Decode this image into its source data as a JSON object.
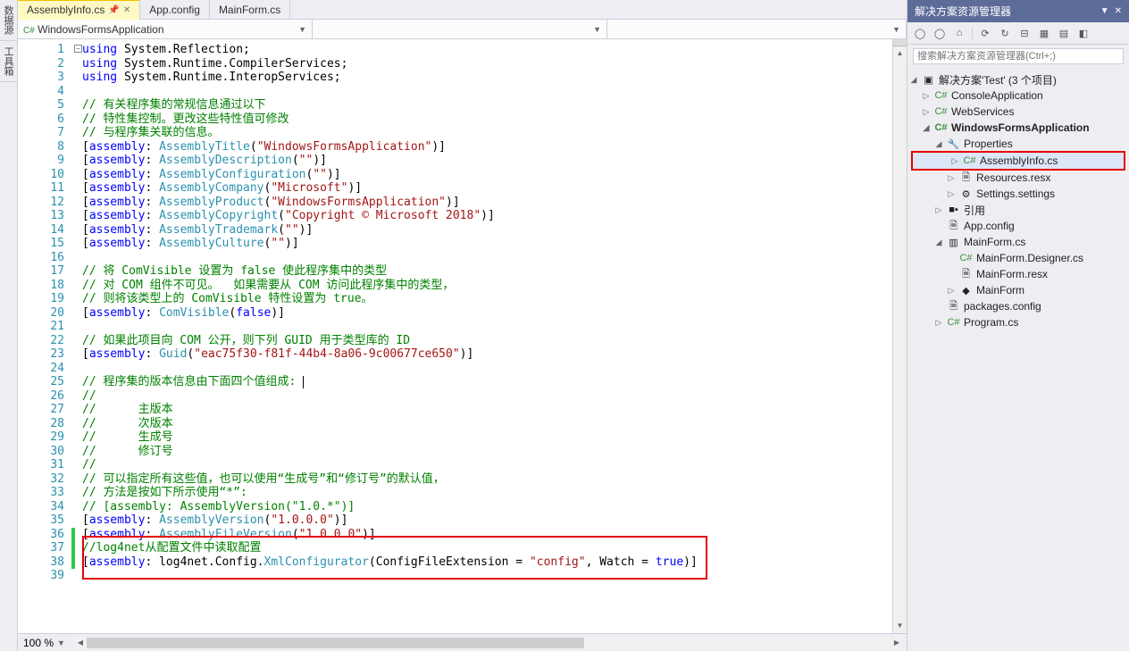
{
  "side_tabs": [
    "数据源",
    "工具箱"
  ],
  "tabs": [
    {
      "label": "AssemblyInfo.cs",
      "active": true
    },
    {
      "label": "App.config",
      "active": false
    },
    {
      "label": "MainForm.cs",
      "active": false
    }
  ],
  "dropdowns": {
    "namespace": "WindowsFormsApplication",
    "class": "",
    "member": ""
  },
  "code_lines": [
    {
      "n": 1,
      "seg": [
        [
          "kw",
          "using"
        ],
        [
          "",
          " System.Reflection;"
        ]
      ]
    },
    {
      "n": 2,
      "seg": [
        [
          "kw",
          "using"
        ],
        [
          "",
          " System.Runtime.CompilerServices;"
        ]
      ]
    },
    {
      "n": 3,
      "seg": [
        [
          "kw",
          "using"
        ],
        [
          "",
          " System.Runtime.InteropServices;"
        ]
      ]
    },
    {
      "n": 4,
      "seg": []
    },
    {
      "n": 5,
      "seg": [
        [
          "cm",
          "// 有关程序集的常规信息通过以下"
        ]
      ]
    },
    {
      "n": 6,
      "seg": [
        [
          "cm",
          "// 特性集控制。更改这些特性值可修改"
        ]
      ]
    },
    {
      "n": 7,
      "seg": [
        [
          "cm",
          "// 与程序集关联的信息。"
        ]
      ]
    },
    {
      "n": 8,
      "seg": [
        [
          "",
          "["
        ],
        [
          "kw",
          "assembly"
        ],
        [
          "",
          ": "
        ],
        [
          "tp",
          "AssemblyTitle"
        ],
        [
          "",
          "("
        ],
        [
          "str",
          "\"WindowsFormsApplication\""
        ],
        [
          "",
          ")]"
        ]
      ]
    },
    {
      "n": 9,
      "seg": [
        [
          "",
          "["
        ],
        [
          "kw",
          "assembly"
        ],
        [
          "",
          ": "
        ],
        [
          "tp",
          "AssemblyDescription"
        ],
        [
          "",
          "("
        ],
        [
          "str",
          "\"\""
        ],
        [
          "",
          ")]"
        ]
      ]
    },
    {
      "n": 10,
      "seg": [
        [
          "",
          "["
        ],
        [
          "kw",
          "assembly"
        ],
        [
          "",
          ": "
        ],
        [
          "tp",
          "AssemblyConfiguration"
        ],
        [
          "",
          "("
        ],
        [
          "str",
          "\"\""
        ],
        [
          "",
          ")]"
        ]
      ]
    },
    {
      "n": 11,
      "seg": [
        [
          "",
          "["
        ],
        [
          "kw",
          "assembly"
        ],
        [
          "",
          ": "
        ],
        [
          "tp",
          "AssemblyCompany"
        ],
        [
          "",
          "("
        ],
        [
          "str",
          "\"Microsoft\""
        ],
        [
          "",
          ")]"
        ]
      ]
    },
    {
      "n": 12,
      "seg": [
        [
          "",
          "["
        ],
        [
          "kw",
          "assembly"
        ],
        [
          "",
          ": "
        ],
        [
          "tp",
          "AssemblyProduct"
        ],
        [
          "",
          "("
        ],
        [
          "str",
          "\"WindowsFormsApplication\""
        ],
        [
          "",
          ")]"
        ]
      ]
    },
    {
      "n": 13,
      "seg": [
        [
          "",
          "["
        ],
        [
          "kw",
          "assembly"
        ],
        [
          "",
          ": "
        ],
        [
          "tp",
          "AssemblyCopyright"
        ],
        [
          "",
          "("
        ],
        [
          "str",
          "\"Copyright © Microsoft 2018\""
        ],
        [
          "",
          ")]"
        ]
      ]
    },
    {
      "n": 14,
      "seg": [
        [
          "",
          "["
        ],
        [
          "kw",
          "assembly"
        ],
        [
          "",
          ": "
        ],
        [
          "tp",
          "AssemblyTrademark"
        ],
        [
          "",
          "("
        ],
        [
          "str",
          "\"\""
        ],
        [
          "",
          ")]"
        ]
      ]
    },
    {
      "n": 15,
      "seg": [
        [
          "",
          "["
        ],
        [
          "kw",
          "assembly"
        ],
        [
          "",
          ": "
        ],
        [
          "tp",
          "AssemblyCulture"
        ],
        [
          "",
          "("
        ],
        [
          "str",
          "\"\""
        ],
        [
          "",
          ")]"
        ]
      ]
    },
    {
      "n": 16,
      "seg": []
    },
    {
      "n": 17,
      "seg": [
        [
          "cm",
          "// 将 ComVisible 设置为 false 使此程序集中的类型"
        ]
      ]
    },
    {
      "n": 18,
      "seg": [
        [
          "cm",
          "// 对 COM 组件不可见。  如果需要从 COM 访问此程序集中的类型，"
        ]
      ]
    },
    {
      "n": 19,
      "seg": [
        [
          "cm",
          "// 则将该类型上的 ComVisible 特性设置为 true。"
        ]
      ]
    },
    {
      "n": 20,
      "seg": [
        [
          "",
          "["
        ],
        [
          "kw",
          "assembly"
        ],
        [
          "",
          ": "
        ],
        [
          "tp",
          "ComVisible"
        ],
        [
          "",
          "("
        ],
        [
          "kw",
          "false"
        ],
        [
          "",
          ")]"
        ]
      ]
    },
    {
      "n": 21,
      "seg": []
    },
    {
      "n": 22,
      "seg": [
        [
          "cm",
          "// 如果此项目向 COM 公开，则下列 GUID 用于类型库的 ID"
        ]
      ]
    },
    {
      "n": 23,
      "seg": [
        [
          "",
          "["
        ],
        [
          "kw",
          "assembly"
        ],
        [
          "",
          ": "
        ],
        [
          "tp",
          "Guid"
        ],
        [
          "",
          "("
        ],
        [
          "str",
          "\"eac75f30-f81f-44b4-8a06-9c00677ce650\""
        ],
        [
          "",
          ")]"
        ]
      ]
    },
    {
      "n": 24,
      "seg": []
    },
    {
      "n": 25,
      "seg": [
        [
          "cm",
          "// 程序集的版本信息由下面四个值组成: "
        ]
      ],
      "cursor": true
    },
    {
      "n": 26,
      "seg": [
        [
          "cm",
          "//"
        ]
      ]
    },
    {
      "n": 27,
      "seg": [
        [
          "cm",
          "//      主版本"
        ]
      ]
    },
    {
      "n": 28,
      "seg": [
        [
          "cm",
          "//      次版本 "
        ]
      ]
    },
    {
      "n": 29,
      "seg": [
        [
          "cm",
          "//      生成号"
        ]
      ]
    },
    {
      "n": 30,
      "seg": [
        [
          "cm",
          "//      修订号"
        ]
      ]
    },
    {
      "n": 31,
      "seg": [
        [
          "cm",
          "//"
        ]
      ]
    },
    {
      "n": 32,
      "seg": [
        [
          "cm",
          "// 可以指定所有这些值，也可以使用“生成号”和“修订号”的默认值，"
        ]
      ]
    },
    {
      "n": 33,
      "seg": [
        [
          "cm",
          "// 方法是按如下所示使用“*”:"
        ]
      ]
    },
    {
      "n": 34,
      "seg": [
        [
          "cm",
          "// [assembly: AssemblyVersion(\"1.0.*\")]"
        ]
      ]
    },
    {
      "n": 35,
      "seg": [
        [
          "",
          "["
        ],
        [
          "kw",
          "assembly"
        ],
        [
          "",
          ": "
        ],
        [
          "tp",
          "AssemblyVersion"
        ],
        [
          "",
          "("
        ],
        [
          "str",
          "\"1.0.0.0\""
        ],
        [
          "",
          ")]"
        ]
      ]
    },
    {
      "n": 36,
      "seg": [
        [
          "",
          "["
        ],
        [
          "kw",
          "assembly"
        ],
        [
          "",
          ": "
        ],
        [
          "tp",
          "AssemblyFileVersion"
        ],
        [
          "",
          "("
        ],
        [
          "str",
          "\"1.0.0.0\""
        ],
        [
          "",
          ")]"
        ]
      ]
    },
    {
      "n": 37,
      "seg": [
        [
          "cm",
          "//log4net从配置文件中读取配置"
        ]
      ]
    },
    {
      "n": 38,
      "seg": [
        [
          "",
          "["
        ],
        [
          "kw",
          "assembly"
        ],
        [
          "",
          ": log4net.Config."
        ],
        [
          "tp",
          "XmlConfigurator"
        ],
        [
          "",
          "(ConfigFileExtension = "
        ],
        [
          "str",
          "\"config\""
        ],
        [
          "",
          ", Watch = "
        ],
        [
          "kw",
          "true"
        ],
        [
          "",
          ")]"
        ]
      ]
    },
    {
      "n": 39,
      "seg": []
    }
  ],
  "zoom": "100 %",
  "sx": {
    "title": "解决方案资源管理器",
    "search_placeholder": "搜索解决方案资源管理器(Ctrl+;)",
    "tree": {
      "solution": "解决方案'Test' (3 个项目)",
      "projects": [
        {
          "name": "ConsoleApplication",
          "expanded": false
        },
        {
          "name": "WebServices",
          "expanded": false
        },
        {
          "name": "WindowsFormsApplication",
          "expanded": true,
          "bold": true,
          "children": [
            {
              "name": "Properties",
              "icon": "wrench",
              "expanded": true,
              "children": [
                {
                  "name": "AssemblyInfo.cs",
                  "icon": "cs",
                  "selected": true,
                  "expandable": true
                },
                {
                  "name": "Resources.resx",
                  "icon": "file",
                  "expandable": true
                },
                {
                  "name": "Settings.settings",
                  "icon": "gear",
                  "expandable": true
                }
              ]
            },
            {
              "name": "引用",
              "icon": "ref",
              "expandable": true
            },
            {
              "name": "App.config",
              "icon": "cfg"
            },
            {
              "name": "MainForm.cs",
              "icon": "form",
              "expanded": true,
              "children": [
                {
                  "name": "MainForm.Designer.cs",
                  "icon": "cs"
                },
                {
                  "name": "MainForm.resx",
                  "icon": "file"
                },
                {
                  "name": "MainForm",
                  "icon": "class",
                  "expandable": true
                }
              ]
            },
            {
              "name": "packages.config",
              "icon": "cfg"
            },
            {
              "name": "Program.cs",
              "icon": "cs",
              "expandable": true
            }
          ]
        }
      ]
    }
  }
}
